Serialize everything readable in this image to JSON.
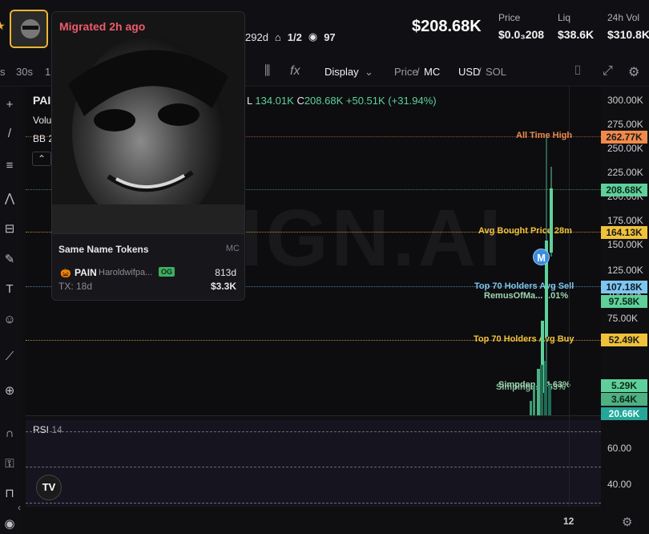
{
  "header": {
    "token_symbol_partial": "PAIN",
    "age": "292d",
    "holders_ratio": "1/2",
    "views": "97",
    "market_cap": "$208.68K",
    "metrics": [
      {
        "label": "Price",
        "value": "$0.0₃208"
      },
      {
        "label": "Liq",
        "value": "$38.6K"
      },
      {
        "label": "24h Vol",
        "value": "$310.8K"
      }
    ]
  },
  "toolbar": {
    "intervals": [
      "s",
      "30s",
      "1"
    ],
    "display": "Display",
    "price_label": "Price",
    "mc_label": "MC",
    "currency": "USD",
    "currency_alt": "SOL"
  },
  "legend": {
    "symbol": "PAI",
    "volume": "Volu",
    "bb": "BB 2",
    "ohlc": "L",
    "low": "134.01K",
    "close_label": "C",
    "close": "208.68K",
    "change": "+50.51K (+31.94%)"
  },
  "popover": {
    "badge": "Migrated 2h ago",
    "section_title": "Same Name Tokens",
    "section_col": "MC",
    "token": {
      "name": "PAIN",
      "creator": "Haroldwifpa...",
      "tag": "OG",
      "age": "813d",
      "tx": "TX: 18d",
      "mc": "$3.3K"
    }
  },
  "chart_data": {
    "type": "candlestick",
    "watermark": "IGN.AI",
    "y_ticks": [
      "300.00K",
      "275.00K",
      "250.00K",
      "225.00K",
      "200.00K",
      "175.00K",
      "150.00K",
      "125.00K",
      "100.00K",
      "75.00K",
      "50.00K"
    ],
    "price_labels": [
      {
        "text": "262.77K",
        "color": "#f08a4b",
        "fg": "#1a1a1a"
      },
      {
        "text": "208.68K",
        "color": "#5fd09a",
        "fg": "#0d2a1a"
      },
      {
        "text": "164.13K",
        "color": "#f0c23a",
        "fg": "#1a1a1a"
      },
      {
        "text": "107.18K",
        "color": "#7fc6ee",
        "fg": "#0d1a2a"
      },
      {
        "text": "97.58K",
        "color": "#5fd09a",
        "fg": "#0d2a1a"
      },
      {
        "text": "52.49K",
        "color": "#f0c23a",
        "fg": "#1a1a1a"
      },
      {
        "text": "5.29K",
        "color": "#5fd09a",
        "fg": "#0d2a1a"
      },
      {
        "text": "3.64K",
        "color": "#4fb083",
        "fg": "#0d2a1a"
      },
      {
        "text": "20.66K",
        "color": "#26a69a",
        "fg": "#e8fff8"
      }
    ],
    "annotations": {
      "ath": "All Time High",
      "avg_bought": "Avg Bought Price 28m",
      "top70_sell": "Top 70 Holders Avg Sell",
      "remus": "RemusOfMa... -.01%",
      "top70_buy": "Top 70 Holders Avg Buy",
      "simp1": "Simpdep... 4.63%",
      "simp2": "Simping... 4.63%"
    },
    "marker": "M",
    "rsi": {
      "label": "RSI",
      "period": "14",
      "ticks": [
        "60.00",
        "40.00"
      ]
    },
    "x_tick": "12"
  }
}
